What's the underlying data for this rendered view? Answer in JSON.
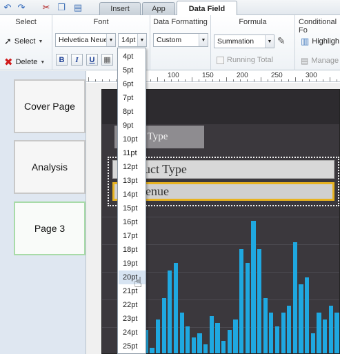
{
  "tabs": [
    {
      "label": "Insert",
      "active": false
    },
    {
      "label": "App",
      "active": false
    },
    {
      "label": "Data Field",
      "active": true
    }
  ],
  "quick_access": [
    "undo-icon",
    "redo-icon",
    "cut-icon",
    "copy-icon",
    "paste-icon"
  ],
  "ribbon": {
    "select_group": {
      "title": "Select",
      "select_label": "Select",
      "delete_label": "Delete"
    },
    "font_group": {
      "title": "Font",
      "font_family": "Helvetica Neue",
      "font_size": "14pt",
      "bold": "B",
      "italic": "I",
      "underline": "U"
    },
    "data_formatting_group": {
      "title": "Data Formatting",
      "format_value": "Custom"
    },
    "formula_group": {
      "title": "Formula",
      "aggregation_value": "Summation",
      "running_total_label": "Running Total"
    },
    "conditional_group": {
      "title": "Conditional Fo",
      "highlight_label": "Highligh",
      "manage_label": "Manage"
    }
  },
  "ruler": {
    "labels": [
      "100",
      "150",
      "200",
      "250",
      "300"
    ]
  },
  "pages": [
    {
      "label": "Cover Page",
      "selected": false
    },
    {
      "label": "Analysis",
      "selected": false
    },
    {
      "label": "Page 3",
      "selected": true
    }
  ],
  "canvas": {
    "title_box_text": "t Type",
    "field1_text": "uct Type",
    "field2_text": "enue"
  },
  "font_size_options": [
    "4pt",
    "5pt",
    "6pt",
    "7pt",
    "8pt",
    "9pt",
    "10pt",
    "11pt",
    "12pt",
    "13pt",
    "14pt",
    "15pt",
    "16pt",
    "17pt",
    "18pt",
    "19pt",
    "20pt",
    "21pt",
    "22pt",
    "23pt",
    "24pt",
    "25pt"
  ],
  "hovered_font_size": "20pt",
  "colors": {
    "accent": "#1fa8e0",
    "selection_border": "#e8b320",
    "dashboard_bg": "#3b383d"
  },
  "chart_data": {
    "type": "bar",
    "values": [
      20,
      35,
      10,
      50,
      80,
      120,
      130,
      60,
      40,
      25,
      30,
      15,
      55,
      45,
      20,
      35,
      50,
      150,
      130,
      190,
      150,
      80,
      60,
      40,
      60,
      70,
      160,
      100,
      110,
      30,
      60,
      50,
      70,
      60
    ]
  }
}
